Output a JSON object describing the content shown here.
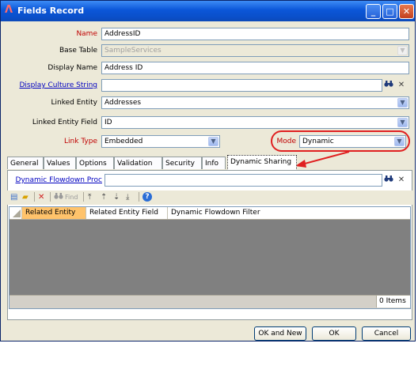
{
  "window": {
    "title": "Fields Record",
    "controls": {
      "minimize": "_",
      "maximize": "□",
      "close": "✕"
    }
  },
  "form": {
    "name": {
      "label": "Name",
      "value": "AddressID"
    },
    "base_table": {
      "label": "Base Table",
      "value": "SampleServices"
    },
    "display_name": {
      "label": "Display Name",
      "value": "Address ID"
    },
    "display_culture": {
      "label": "Display Culture String",
      "value": ""
    },
    "linked_entity": {
      "label": "Linked Entity",
      "value": "Addresses"
    },
    "linked_entity_field": {
      "label": "Linked Entity Field",
      "value": "ID"
    },
    "link_type": {
      "label": "Link Type",
      "value": "Embedded"
    },
    "mode": {
      "label": "Mode",
      "value": "Dynamic"
    }
  },
  "tabs": [
    "General",
    "Values",
    "Options",
    "Validation",
    "Security",
    "Info",
    "Dynamic Sharing"
  ],
  "dynamic_sharing": {
    "proc_label": "Dynamic Flowdown Proc",
    "proc_value": "",
    "toolbar": {
      "find": "Find"
    },
    "grid": {
      "columns": [
        "Related Entity",
        "Related Entity Field",
        "Dynamic Flowdown Filter"
      ],
      "items_count": "0 Items"
    }
  },
  "buttons": {
    "ok_new": "OK and New",
    "ok": "OK",
    "cancel": "Cancel"
  },
  "colors": {
    "title_bar": "#0b56d8",
    "highlight": "#e02020",
    "selected_column": "#ffc36b"
  }
}
